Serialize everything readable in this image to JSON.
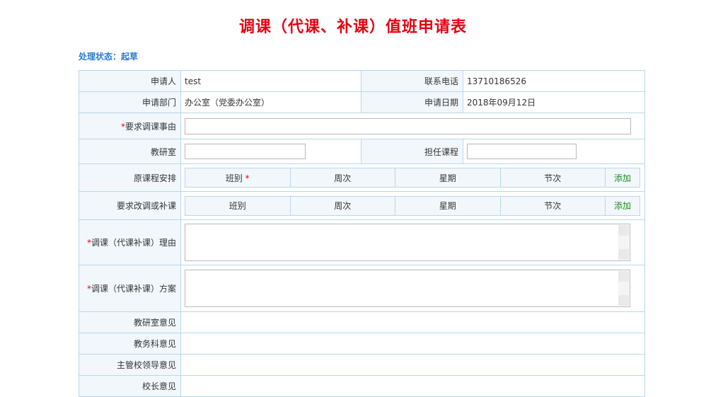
{
  "title": "调课（代课、补课）值班申请表",
  "status": {
    "label": "处理状态：",
    "value": "起草"
  },
  "applicant": {
    "label": "申请人",
    "value": "test"
  },
  "phone": {
    "label": "联系电话",
    "value": "13710186526"
  },
  "department": {
    "label": "申请部门",
    "value": "办公室（党委办公室）"
  },
  "apply_date": {
    "label": "申请日期",
    "value": "2018年09月12日"
  },
  "reason_req": {
    "label": "要求调课事由",
    "value": ""
  },
  "research_room": {
    "label": "教研室",
    "value": ""
  },
  "course": {
    "label": "担任课程",
    "value": ""
  },
  "original_schedule": {
    "label": "原课程安排",
    "columns": [
      "班别",
      "周次",
      "星期",
      "节次"
    ],
    "required_mark": "*",
    "add_label": "添加"
  },
  "changed_schedule": {
    "label": "要求改调或补课",
    "columns": [
      "班别",
      "周次",
      "星期",
      "节次"
    ],
    "add_label": "添加"
  },
  "change_reason": {
    "label": "调课（代课补课）理由",
    "value": ""
  },
  "change_plan": {
    "label": "调课（代课补课）方案",
    "value": ""
  },
  "opinions": [
    {
      "label": "教研室意见"
    },
    {
      "label": "教务科意见"
    },
    {
      "label": "主管校领导意见"
    },
    {
      "label": "校长意见"
    }
  ]
}
